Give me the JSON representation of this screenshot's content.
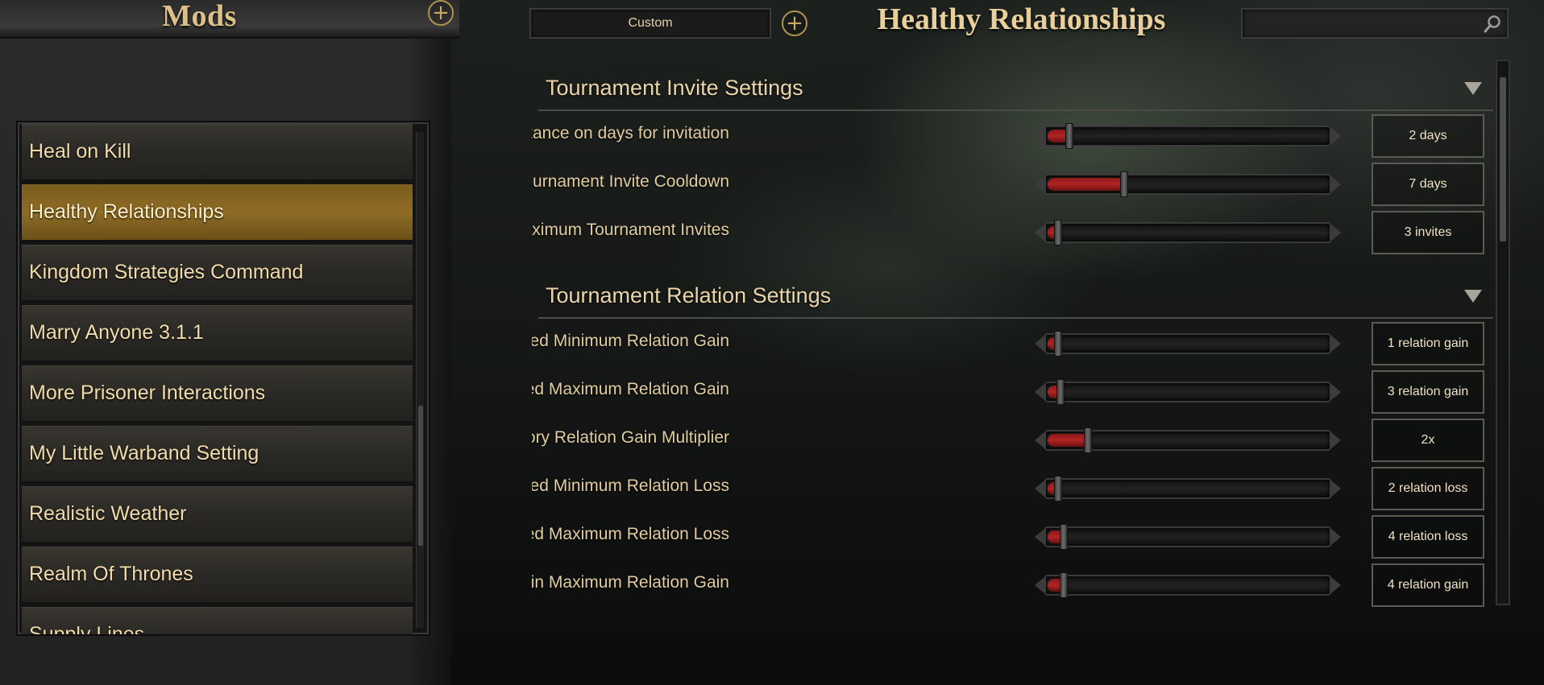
{
  "mods_panel": {
    "title": "Mods",
    "add_icon": "plus-circle-icon",
    "items": [
      {
        "label": "Heal on Kill",
        "selected": false
      },
      {
        "label": "Healthy Relationships",
        "selected": true
      },
      {
        "label": "Kingdom Strategies Command",
        "selected": false
      },
      {
        "label": "Marry Anyone 3.1.1",
        "selected": false
      },
      {
        "label": "More Prisoner Interactions",
        "selected": false
      },
      {
        "label": "My Little Warband Setting",
        "selected": false
      },
      {
        "label": "Realistic Weather",
        "selected": false
      },
      {
        "label": "Realm Of Thrones",
        "selected": false
      },
      {
        "label": "Supply Lines",
        "selected": false
      }
    ]
  },
  "topbar": {
    "preset_value": "Custom",
    "add_preset_icon": "plus-circle-icon",
    "page_title": "Healthy Relationships",
    "search_placeholder": "",
    "search_icon": "search-icon"
  },
  "colors": {
    "accent_gold": "#8f6c24",
    "text_gold": "#e9d3a8",
    "slider_fill": "#b02424"
  },
  "sections": [
    {
      "title": "Tournament Invite Settings",
      "settings": [
        {
          "label": "Tournament Distance on days for invitation",
          "value": "2 days",
          "fill": 0.04
        },
        {
          "label": "Tournament Invite Cooldown",
          "value": "7 days",
          "fill": 0.24
        },
        {
          "label": "Maximum Tournament Invites",
          "value": "3 invites",
          "fill": 0.0
        }
      ]
    },
    {
      "title": "Tournament Relation Settings",
      "settings": [
        {
          "label": "Invite Fulfilled Minimum Relation Gain",
          "value": "1 relation gain",
          "fill": 0.0
        },
        {
          "label": "Invite Fulfilled Maximum Relation Gain",
          "value": "3 relation gain",
          "fill": 0.01
        },
        {
          "label": "Invited Tournament Victory Relation Gain Multiplier",
          "value": "2x",
          "fill": 0.11
        },
        {
          "label": "Invite Unfulfilled Minimum Relation Loss",
          "value": "2 relation loss",
          "fill": 0.0
        },
        {
          "label": "Invite Unfulfilled Maximum Relation Loss",
          "value": "4 relation loss",
          "fill": 0.02
        },
        {
          "label": "Dedicate Tournament Win Maximum Relation Gain",
          "value": "4 relation gain",
          "fill": 0.02
        }
      ]
    }
  ]
}
